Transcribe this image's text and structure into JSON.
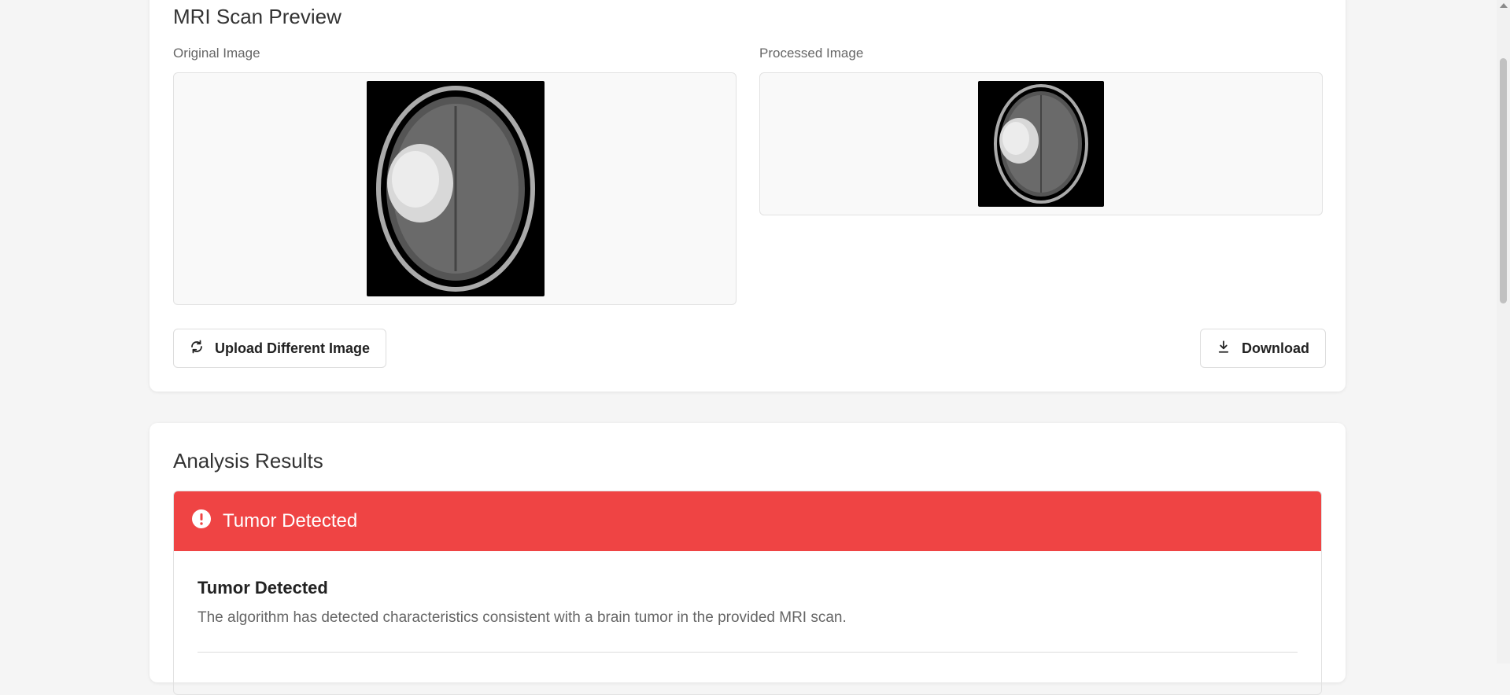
{
  "preview": {
    "title": "MRI Scan Preview",
    "original_label": "Original Image",
    "processed_label": "Processed Image",
    "upload_button": "Upload Different Image",
    "download_button": "Download"
  },
  "results": {
    "title": "Analysis Results",
    "status_banner": "Tumor Detected",
    "result_title": "Tumor Detected",
    "result_description": "The algorithm has detected characteristics consistent with a brain tumor in the provided MRI scan.",
    "status_color": "#ef4444"
  },
  "icons": {
    "upload": "refresh-icon",
    "download": "download-icon",
    "alert": "alert-circle-icon"
  }
}
